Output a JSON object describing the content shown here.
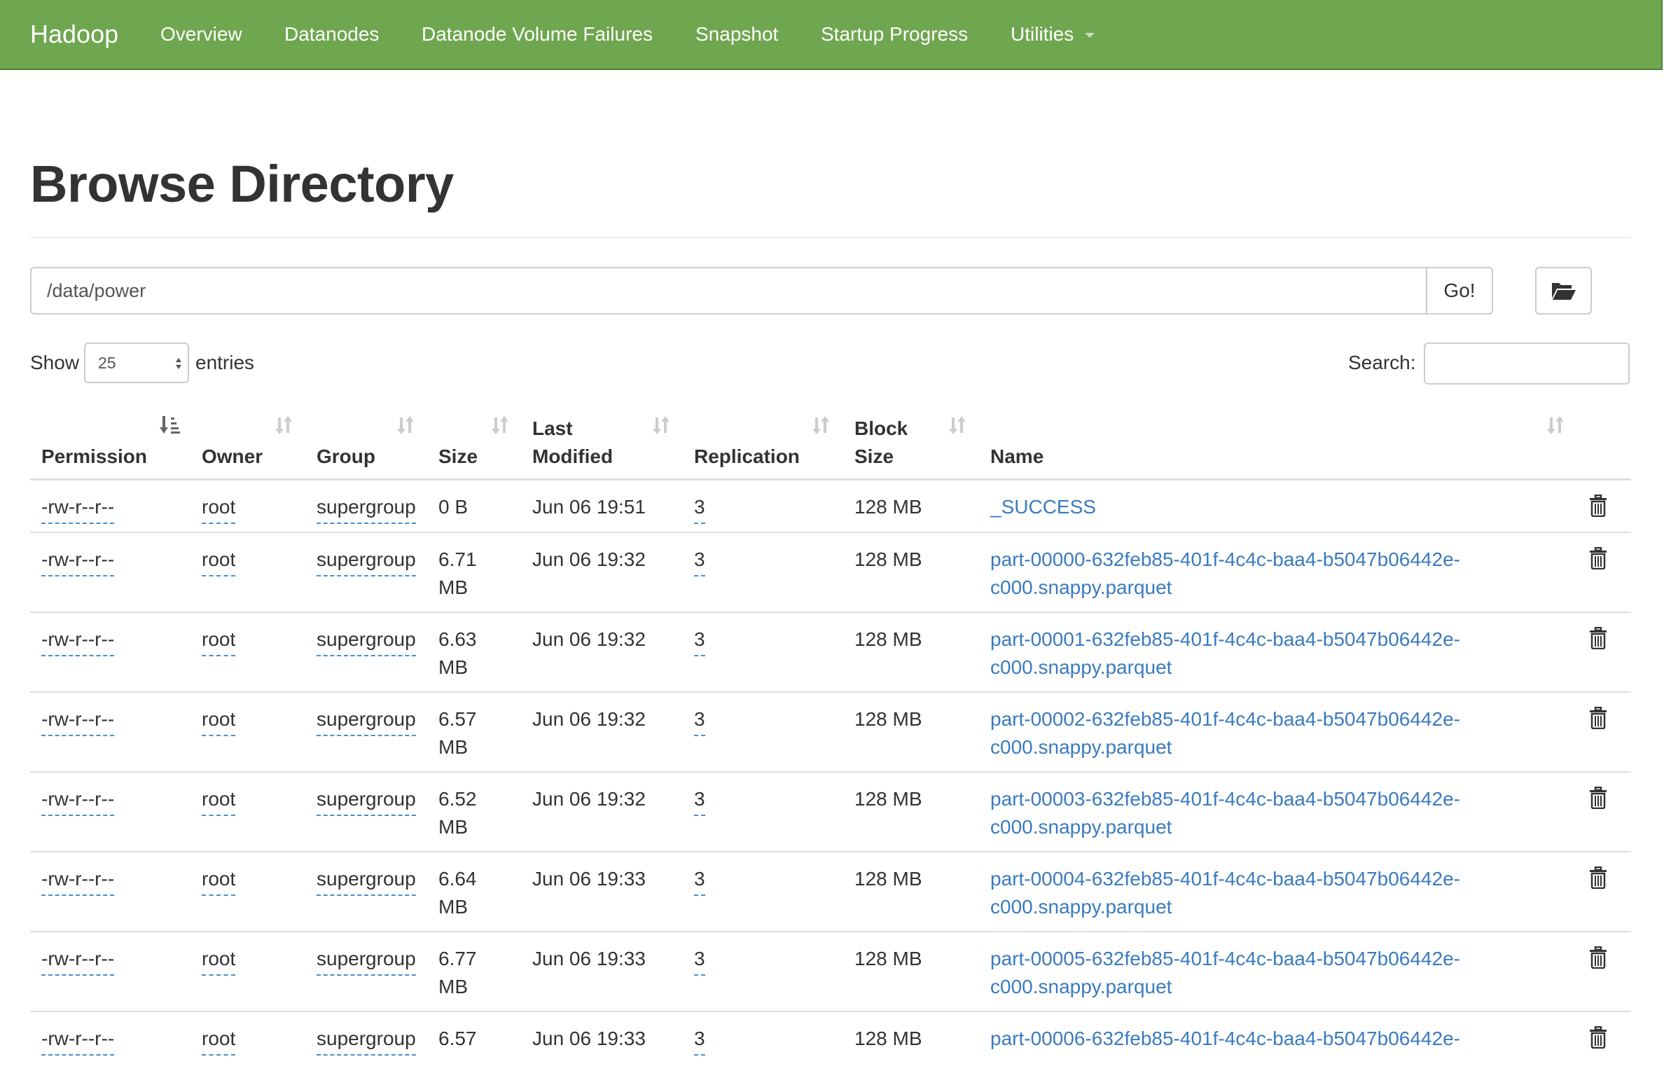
{
  "navbar": {
    "brand": "Hadoop",
    "items": [
      "Overview",
      "Datanodes",
      "Datanode Volume Failures",
      "Snapshot",
      "Startup Progress",
      "Utilities"
    ],
    "bg_color": "#6fa650"
  },
  "page": {
    "title": "Browse Directory"
  },
  "path_bar": {
    "value": "/data/power",
    "go_label": "Go!",
    "folder_icon": "folder-open-icon"
  },
  "entries": {
    "show_label": "Show",
    "selected": "25",
    "entries_label": "entries"
  },
  "search": {
    "label": "Search:",
    "value": ""
  },
  "table": {
    "headers": {
      "permission": "Permission",
      "owner": "Owner",
      "group": "Group",
      "size": "Size",
      "last_modified_1": "Last",
      "last_modified_2": "Modified",
      "replication": "Replication",
      "block_size_1": "Block",
      "block_size_2": "Size",
      "name": "Name"
    },
    "rows": [
      {
        "permission": "-rw-r--r--",
        "owner": "root",
        "group": "supergroup",
        "size_1": "0 B",
        "size_2": "",
        "modified": "Jun 06 19:51",
        "replication": "3",
        "block_size": "128 MB",
        "name_1": "_SUCCESS",
        "name_2": ""
      },
      {
        "permission": "-rw-r--r--",
        "owner": "root",
        "group": "supergroup",
        "size_1": "6.71",
        "size_2": "MB",
        "modified": "Jun 06 19:32",
        "replication": "3",
        "block_size": "128 MB",
        "name_1": "part-00000-632feb85-401f-4c4c-baa4-b5047b06442e-",
        "name_2": "c000.snappy.parquet"
      },
      {
        "permission": "-rw-r--r--",
        "owner": "root",
        "group": "supergroup",
        "size_1": "6.63",
        "size_2": "MB",
        "modified": "Jun 06 19:32",
        "replication": "3",
        "block_size": "128 MB",
        "name_1": "part-00001-632feb85-401f-4c4c-baa4-b5047b06442e-",
        "name_2": "c000.snappy.parquet"
      },
      {
        "permission": "-rw-r--r--",
        "owner": "root",
        "group": "supergroup",
        "size_1": "6.57",
        "size_2": "MB",
        "modified": "Jun 06 19:32",
        "replication": "3",
        "block_size": "128 MB",
        "name_1": "part-00002-632feb85-401f-4c4c-baa4-b5047b06442e-",
        "name_2": "c000.snappy.parquet"
      },
      {
        "permission": "-rw-r--r--",
        "owner": "root",
        "group": "supergroup",
        "size_1": "6.52",
        "size_2": "MB",
        "modified": "Jun 06 19:32",
        "replication": "3",
        "block_size": "128 MB",
        "name_1": "part-00003-632feb85-401f-4c4c-baa4-b5047b06442e-",
        "name_2": "c000.snappy.parquet"
      },
      {
        "permission": "-rw-r--r--",
        "owner": "root",
        "group": "supergroup",
        "size_1": "6.64",
        "size_2": "MB",
        "modified": "Jun 06 19:33",
        "replication": "3",
        "block_size": "128 MB",
        "name_1": "part-00004-632feb85-401f-4c4c-baa4-b5047b06442e-",
        "name_2": "c000.snappy.parquet"
      },
      {
        "permission": "-rw-r--r--",
        "owner": "root",
        "group": "supergroup",
        "size_1": "6.77",
        "size_2": "MB",
        "modified": "Jun 06 19:33",
        "replication": "3",
        "block_size": "128 MB",
        "name_1": "part-00005-632feb85-401f-4c4c-baa4-b5047b06442e-",
        "name_2": "c000.snappy.parquet"
      },
      {
        "permission": "-rw-r--r--",
        "owner": "root",
        "group": "supergroup",
        "size_1": "6.57",
        "size_2": "",
        "modified": "Jun 06 19:33",
        "replication": "3",
        "block_size": "128 MB",
        "name_1": "part-00006-632feb85-401f-4c4c-baa4-b5047b06442e-",
        "name_2": ""
      }
    ]
  },
  "colors": {
    "link": "#3a7bbf",
    "dotted_underline": "#4a8ed0",
    "text": "#333333"
  }
}
